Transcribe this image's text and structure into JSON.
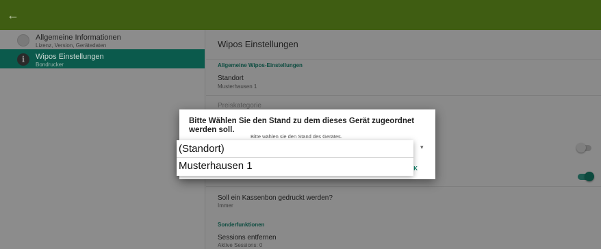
{
  "appbar": {
    "back_icon": "arrow-back-icon",
    "back_glyph": "←"
  },
  "sidebar": {
    "items": [
      {
        "title": "Allgemeine Informationen",
        "subtitle": "Lizenz, Version, Gerätedaten",
        "icon": "info-icon"
      },
      {
        "title": "Wipos Einstellungen",
        "subtitle": "Bondrucker",
        "icon": "info-icon",
        "glyph": "i"
      }
    ]
  },
  "main": {
    "title": "Wipos Einstellungen",
    "section_general": "Allgemeine Wipos-Einstellungen",
    "standort": {
      "title": "Standort",
      "value": "Musterhausen 1"
    },
    "preiskategorie": {
      "title": "Preiskategorie"
    },
    "kassenbon": {
      "title": "Soll ein Kassenbon gedruckt werden?",
      "value": "Immer"
    },
    "section_special": "Sonderfunktionen",
    "sessions": {
      "title": "Sessions entfernen",
      "value": "Aktive Sessions: 0"
    }
  },
  "dialog": {
    "title": "Bitte Wählen Sie den Stand zu dem dieses Gerät zugeordnet werden soll.",
    "message": "Bitte wählen sie den Stand des Gerätes.",
    "ok_label": "OK",
    "dropdown_arrow": "▾",
    "options": [
      "(Standort)",
      "Musterhausen 1"
    ]
  },
  "colors": {
    "appbar": "#3f5d12",
    "accent": "#0b5a4c",
    "ok": "#0b7f67"
  }
}
